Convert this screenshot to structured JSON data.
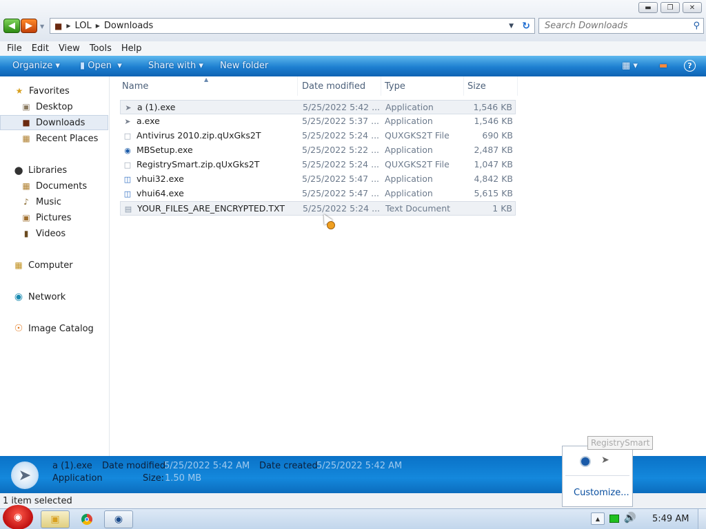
{
  "address": {
    "segments": [
      "LOL",
      "Downloads"
    ]
  },
  "search": {
    "placeholder": "Search Downloads"
  },
  "menu": [
    "File",
    "Edit",
    "View",
    "Tools",
    "Help"
  ],
  "toolbar": {
    "organize": "Organize",
    "open": "Open",
    "share_with": "Share with",
    "new_folder": "New folder"
  },
  "navigation": {
    "favorites": "Favorites",
    "desktop": "Desktop",
    "downloads": "Downloads",
    "recent_places": "Recent Places",
    "libraries": "Libraries",
    "documents": "Documents",
    "music": "Music",
    "pictures": "Pictures",
    "videos": "Videos",
    "computer": "Computer",
    "network": "Network",
    "image_catalog": "Image Catalog"
  },
  "columns": {
    "name": "Name",
    "date_modified": "Date modified",
    "type": "Type",
    "size": "Size"
  },
  "files": [
    {
      "name": "a (1).exe",
      "date": "5/25/2022 5:42 ...",
      "type": "Application",
      "size": "1,546 KB",
      "icon": "rocket-icon"
    },
    {
      "name": "a.exe",
      "date": "5/25/2022 5:37 ...",
      "type": "Application",
      "size": "1,546 KB",
      "icon": "rocket-icon"
    },
    {
      "name": "Antivirus 2010.zip.qUxGks2T",
      "date": "5/25/2022 5:24 ...",
      "type": "QUXGKS2T File",
      "size": "690 KB",
      "icon": "generic-file-icon"
    },
    {
      "name": "MBSetup.exe",
      "date": "5/25/2022 5:22 ...",
      "type": "Application",
      "size": "2,487 KB",
      "icon": "malwarebytes-icon"
    },
    {
      "name": "RegistrySmart.zip.qUxGks2T",
      "date": "5/25/2022 5:24 ...",
      "type": "QUXGKS2T File",
      "size": "1,047 KB",
      "icon": "generic-file-icon"
    },
    {
      "name": "vhui32.exe",
      "date": "5/25/2022 5:47 ...",
      "type": "Application",
      "size": "4,842 KB",
      "icon": "app-window-icon"
    },
    {
      "name": "vhui64.exe",
      "date": "5/25/2022 5:47 ...",
      "type": "Application",
      "size": "5,615 KB",
      "icon": "app-window-icon"
    },
    {
      "name": "YOUR_FILES_ARE_ENCRYPTED.TXT",
      "date": "5/25/2022 5:24 ...",
      "type": "Text Document",
      "size": "1 KB",
      "icon": "text-document-icon"
    }
  ],
  "details": {
    "filename": "a (1).exe",
    "filetype": "Application",
    "date_modified_label": "Date modified:",
    "date_modified_value": "5/25/2022 5:42 AM",
    "size_label": "Size:",
    "size_value": "1.50 MB",
    "date_created_label": "Date created:",
    "date_created_value": "5/25/2022 5:42 AM"
  },
  "status": "1 item selected",
  "tray": {
    "tooltip": "RegistrySmart",
    "customize": "Customize...",
    "clock": "5:49 AM"
  }
}
